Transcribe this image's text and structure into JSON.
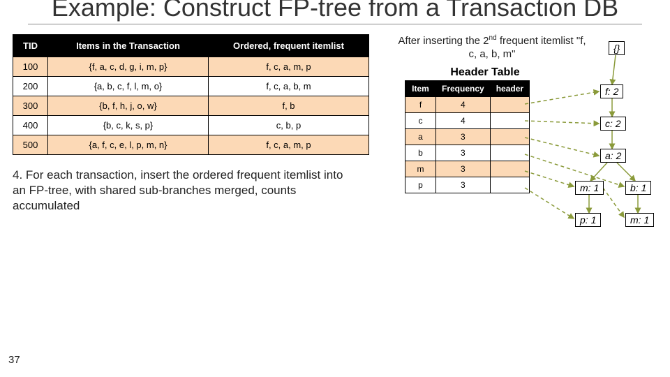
{
  "title": "Example: Construct FP-tree from a Transaction DB",
  "page_number": "37",
  "tx_table": {
    "headers": [
      "TID",
      "Items in the Transaction",
      "Ordered, frequent itemlist"
    ],
    "rows": [
      {
        "tid": "100",
        "items": "{f, a, c, d, g, i, m, p}",
        "ordered": "f, c, a, m, p"
      },
      {
        "tid": "200",
        "items": "{a, b, c, f, l, m, o}",
        "ordered": "f, c, a, b, m"
      },
      {
        "tid": "300",
        "items": "{b, f, h, j, o, w}",
        "ordered": "f, b"
      },
      {
        "tid": "400",
        "items": "{b, c, k, s, p}",
        "ordered": "c, b, p"
      },
      {
        "tid": "500",
        "items": "{a, f, c, e, l, p, m, n}",
        "ordered": "f, c, a, m, p"
      }
    ]
  },
  "step_text": "4.  For each transaction, insert the ordered frequent itemlist into an FP-tree, with shared sub-branches merged, counts accumulated",
  "after_text_parts": {
    "prefix": "After inserting the 2",
    "sup": "nd",
    "suffix": " frequent itemlist \"f, c, a, b, m\""
  },
  "header_table": {
    "title": "Header Table",
    "headers": [
      "Item",
      "Frequency",
      "header"
    ],
    "rows": [
      {
        "item": "f",
        "freq": "4"
      },
      {
        "item": "c",
        "freq": "4"
      },
      {
        "item": "a",
        "freq": "3"
      },
      {
        "item": "b",
        "freq": "3"
      },
      {
        "item": "m",
        "freq": "3"
      },
      {
        "item": "p",
        "freq": "3"
      }
    ]
  },
  "tree": {
    "root": "{}",
    "nodes": {
      "f": "f: 2",
      "c": "c: 2",
      "a": "a: 2",
      "m": "m: 1",
      "p": "p: 1",
      "b": "b: 1",
      "m2": "m: 1"
    }
  },
  "chart_data": {
    "type": "table",
    "transaction_table": {
      "columns": [
        "TID",
        "Items in the Transaction",
        "Ordered, frequent itemlist"
      ],
      "rows": [
        [
          "100",
          "{f, a, c, d, g, i, m, p}",
          "f, c, a, m, p"
        ],
        [
          "200",
          "{a, b, c, f, l, m, o}",
          "f, c, a, b, m"
        ],
        [
          "300",
          "{b, f, h, j, o, w}",
          "f, b"
        ],
        [
          "400",
          "{b, c, k, s, p}",
          "c, b, p"
        ],
        [
          "500",
          "{a, f, c, e, l, p, m, n}",
          "f, c, a, m, p"
        ]
      ]
    },
    "header_table": {
      "columns": [
        "Item",
        "Frequency"
      ],
      "rows": [
        [
          "f",
          4
        ],
        [
          "c",
          4
        ],
        [
          "a",
          3
        ],
        [
          "b",
          3
        ],
        [
          "m",
          3
        ],
        [
          "p",
          3
        ]
      ]
    },
    "fp_tree_after_insert": {
      "inserted_itemlist": "f, c, a, b, m",
      "root": "{}",
      "edges": [
        [
          "{}",
          "f:2"
        ],
        [
          "f:2",
          "c:2"
        ],
        [
          "c:2",
          "a:2"
        ],
        [
          "a:2",
          "m:1"
        ],
        [
          "m:1",
          "p:1"
        ],
        [
          "a:2",
          "b:1"
        ],
        [
          "b:1",
          "m:1"
        ]
      ],
      "header_links": [
        [
          "f",
          "f:2"
        ],
        [
          "c",
          "c:2"
        ],
        [
          "a",
          "a:2"
        ],
        [
          "b",
          "b:1"
        ],
        [
          "m",
          "m:1"
        ],
        [
          "m",
          "m:1(b-branch)"
        ],
        [
          "p",
          "p:1"
        ]
      ]
    }
  }
}
